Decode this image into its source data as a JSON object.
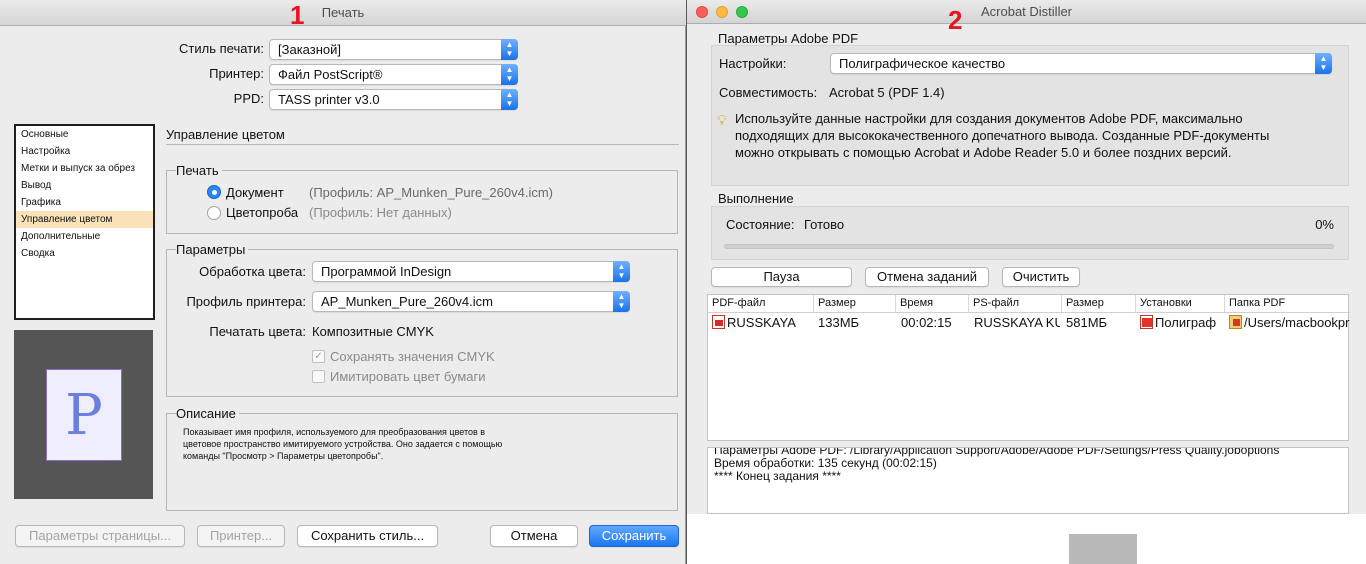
{
  "markers": {
    "left": "1",
    "right": "2"
  },
  "print_dialog": {
    "title": "Печать",
    "fields": {
      "style_label": "Стиль печати:",
      "style_value": "[Заказной]",
      "printer_label": "Принтер:",
      "printer_value": "Файл PostScript®",
      "ppd_label": "PPD:",
      "ppd_value": "TASS printer v3.0"
    },
    "nav_items": [
      "Основные",
      "Настройка",
      "Метки и выпуск за обрез",
      "Вывод",
      "Графика",
      "Управление цветом",
      "Дополнительные",
      "Сводка"
    ],
    "nav_selected": "Управление цветом",
    "preview_letter": "P",
    "section_title": "Управление цветом",
    "print_group": {
      "title": "Печать",
      "document_label": "Документ",
      "document_profile": "(Профиль: AP_Munken_Pure_260v4.icm)",
      "proof_label": "Цветопроба",
      "proof_profile": "(Профиль: Нет данных)"
    },
    "params_group": {
      "title": "Параметры",
      "color_handling_label": "Обработка цвета:",
      "color_handling_value": "Программой InDesign",
      "printer_profile_label": "Профиль принтера:",
      "printer_profile_value": "AP_Munken_Pure_260v4.icm",
      "print_colors_label": "Печатать цвета:",
      "print_colors_value": "Композитные CMYK",
      "preserve_cmyk": "Сохранять значения CMYK",
      "simulate_paper": "Имитировать цвет бумаги"
    },
    "description_group": {
      "title": "Описание",
      "lines": [
        "Показывает имя профиля, используемого для преобразования цветов в",
        "цветовое пространство имитируемого устройства. Оно задается с помощью",
        "команды \"Просмотр > Параметры цветопробы\"."
      ]
    },
    "buttons": {
      "page_setup": "Параметры страницы...",
      "printer": "Принтер...",
      "save_style": "Сохранить стиль...",
      "cancel": "Отмена",
      "save": "Сохранить"
    }
  },
  "distiller": {
    "title": "Acrobat Distiller",
    "pdf_settings_title": "Параметры Adobe PDF",
    "settings_label": "Настройки:",
    "settings_value": "Полиграфическое качество",
    "compat_label": "Совместимость:",
    "compat_value": "Acrobat 5 (PDF 1.4)",
    "info_lines": [
      "Используйте данные настройки для создания документов Adobe PDF, максимально",
      "подходящих для высококачественного допечатного вывода.  Созданные PDF-документы",
      "можно открывать с помощью Acrobat и Adobe Reader 5.0 и более поздних версий."
    ],
    "execution_title": "Выполнение",
    "status_label": "Состояние:",
    "status_value": "Готово",
    "progress_text": "0%",
    "progress_fraction": 0,
    "buttons": {
      "pause": "Пауза",
      "cancel_jobs": "Отмена заданий",
      "clear": "Очистить"
    },
    "columns": [
      "PDF-файл",
      "Размер",
      "Время",
      "PS-файл",
      "Размер",
      "Установки",
      "Папка PDF"
    ],
    "rows": [
      {
        "pdf": "RUSSKAYA",
        "size": "133МБ",
        "time": "00:02:15",
        "ps": "RUSSKAYA KUBAN",
        "ps_size": "581МБ",
        "settings": "Полиграф",
        "folder": "/Users/macbookpro"
      }
    ],
    "log_lines": [
      "Параметры Adobe PDF: /Library/Application Support/Adobe/Adobe PDF/Settings/Press Quality.joboptions",
      "Время обработки: 135 секунд (00:02:15)",
      "**** Конец задания ****"
    ]
  },
  "colors": {
    "accent": "#1a73e8",
    "selection": "#fbe2b8",
    "marker": "#e8141e",
    "close": "#fc605c",
    "minimize": "#fdbc40",
    "zoom": "#34c84a"
  }
}
